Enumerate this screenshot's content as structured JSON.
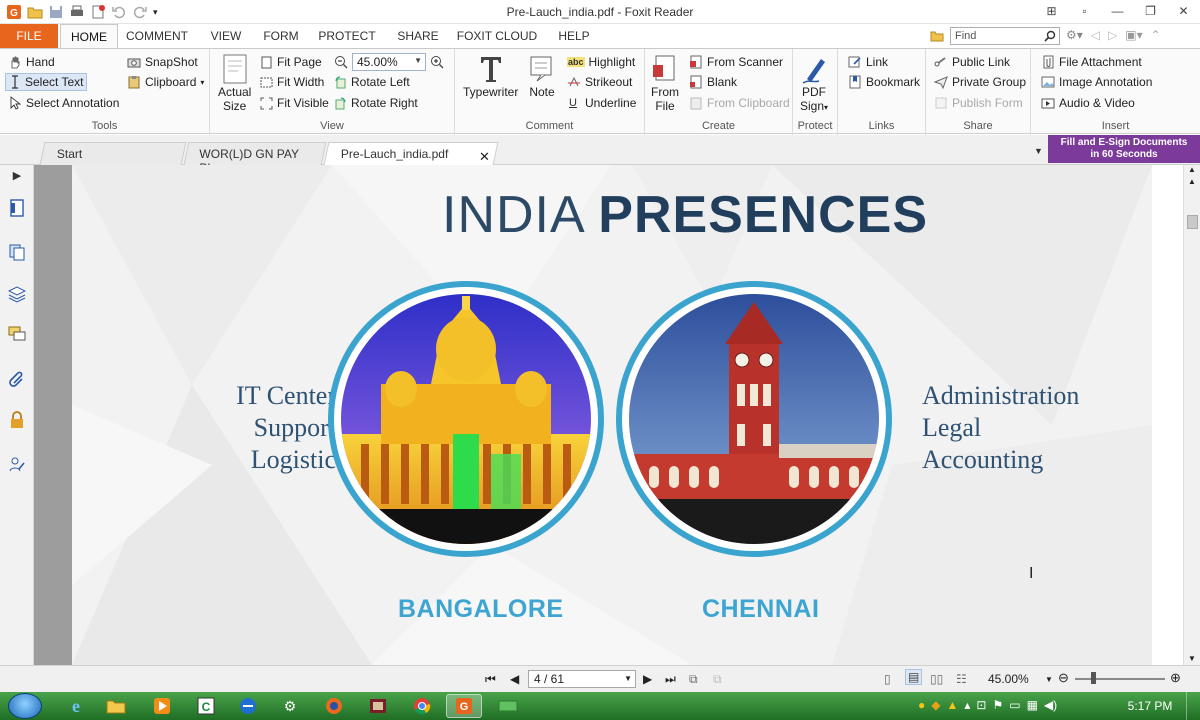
{
  "window": {
    "title": "Pre-Lauch_india.pdf - Foxit Reader"
  },
  "ribbon_tabs": [
    "FILE",
    "HOME",
    "COMMENT",
    "VIEW",
    "FORM",
    "PROTECT",
    "SHARE",
    "FOXIT CLOUD",
    "HELP"
  ],
  "find": {
    "placeholder": "Find"
  },
  "ribbon": {
    "tools": {
      "label": "Tools",
      "hand": "Hand",
      "select_text": "Select Text",
      "select_annotation": "Select Annotation",
      "snapshot": "SnapShot",
      "clipboard": "Clipboard"
    },
    "view": {
      "label": "View",
      "actual_size_1": "Actual",
      "actual_size_2": "Size",
      "fit_page": "Fit Page",
      "fit_width": "Fit Width",
      "fit_visible": "Fit Visible",
      "zoom": "45.00%",
      "rotate_left": "Rotate Left",
      "rotate_right": "Rotate Right"
    },
    "comment": {
      "label": "Comment",
      "typewriter": "Typewriter",
      "note": "Note",
      "highlight": "Highlight",
      "strikeout": "Strikeout",
      "underline": "Underline"
    },
    "create": {
      "label": "Create",
      "from_file_1": "From",
      "from_file_2": "File",
      "from_scanner": "From Scanner",
      "blank": "Blank",
      "from_clipboard": "From Clipboard"
    },
    "protect": {
      "label": "Protect",
      "pdf_sign_1": "PDF",
      "pdf_sign_2": "Sign"
    },
    "links": {
      "label": "Links",
      "link": "Link",
      "bookmark": "Bookmark"
    },
    "share": {
      "label": "Share",
      "public_link": "Public Link",
      "private_group": "Private Group",
      "publish_form": "Publish Form"
    },
    "insert": {
      "label": "Insert",
      "file_attachment": "File Attachment",
      "image_annotation": "Image Annotation",
      "audio_video": "Audio & Video"
    }
  },
  "doc_tabs": [
    "Start",
    "WOR(L)D GN PAY PL...",
    "Pre-Lauch_india.pdf"
  ],
  "ad_banner": {
    "line1": "Fill and E-Sign Documents",
    "line2": "in 60 Seconds"
  },
  "slide": {
    "title_light": "INDIA ",
    "title_bold": "PRESENCES",
    "left_items": [
      "IT Center",
      "Support",
      "Logistic"
    ],
    "right_items": [
      "Administration",
      "Legal",
      "Accounting"
    ],
    "city_left": "BANGALORE",
    "city_right": "CHENNAI"
  },
  "status": {
    "page": "4 / 61",
    "zoom": "45.00%"
  },
  "taskbar": {
    "time": "5:17 PM"
  },
  "colors": {
    "file_tab": "#e8651d",
    "accent_ring": "#3aa4cf",
    "title_navy": "#213f5d",
    "city_blue": "#3ea5d2",
    "ad_purple": "#7c3b9a"
  }
}
